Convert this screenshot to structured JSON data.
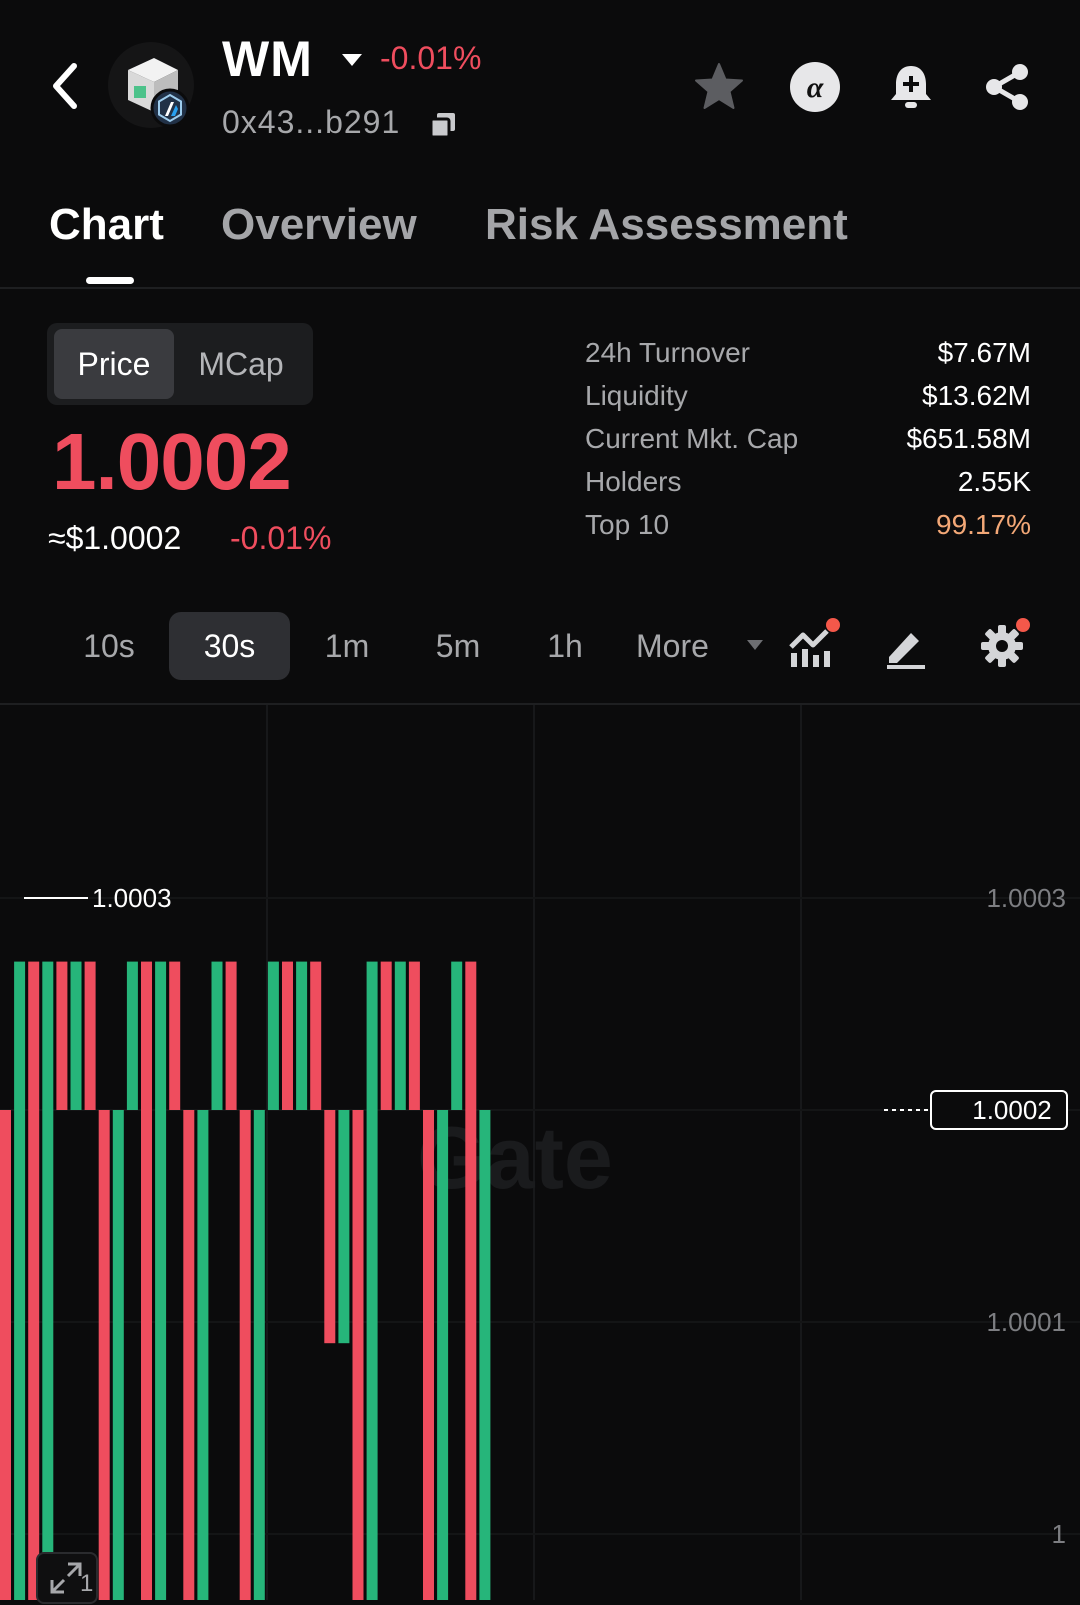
{
  "header": {
    "title": "WM",
    "change": "-0.01%",
    "address": "0x43...b291"
  },
  "tabs": [
    "Chart",
    "Overview",
    "Risk Assessment"
  ],
  "toggle": {
    "price": "Price",
    "mcap": "MCap"
  },
  "price": {
    "value": "1.0002",
    "usd": "≈$1.0002",
    "change": "-0.01%"
  },
  "stats": [
    {
      "label": "24h Turnover",
      "value": "$7.67M"
    },
    {
      "label": "Liquidity",
      "value": "$13.62M"
    },
    {
      "label": "Current Mkt. Cap",
      "value": "$651.58M"
    },
    {
      "label": "Holders",
      "value": "2.55K"
    },
    {
      "label": "Top 10",
      "value": "99.17%"
    }
  ],
  "timeframes": [
    "10s",
    "30s",
    "1m",
    "5m",
    "1h",
    "More"
  ],
  "selected_timeframe": "30s",
  "colors": {
    "up": "#26b57a",
    "down": "#ef4d5e",
    "top10": "#f3a877",
    "background": "#0b0b0c"
  },
  "icons": [
    "back-icon",
    "token-logo-icon",
    "arbitrum-badge-icon",
    "copy-icon",
    "star-icon",
    "alpha-icon",
    "bell-plus-icon",
    "share-icon",
    "indicators-icon",
    "draw-icon",
    "settings-icon",
    "expand-icon"
  ],
  "watermark": "Gate",
  "chart_data": {
    "type": "candlestick",
    "y_ticks": [
      "1.0003",
      "1.0002",
      "1.0001",
      "1"
    ],
    "high_label": "1.0003",
    "current_price_label": "1.0002",
    "corner_label": "1",
    "candles": [
      {
        "open": 1.0002,
        "close": 0.99993,
        "dir": "down"
      },
      {
        "open": 0.99993,
        "close": 1.00027,
        "dir": "up"
      },
      {
        "open": 1.00027,
        "close": 0.99993,
        "dir": "down"
      },
      {
        "open": 0.99993,
        "close": 1.00027,
        "dir": "up"
      },
      {
        "open": 1.00027,
        "close": 1.0002,
        "dir": "down"
      },
      {
        "open": 1.0002,
        "close": 1.00027,
        "dir": "up"
      },
      {
        "open": 1.00027,
        "close": 1.0002,
        "dir": "down"
      },
      {
        "open": 1.0002,
        "close": 0.99993,
        "dir": "down"
      },
      {
        "open": 0.99993,
        "close": 1.0002,
        "dir": "up"
      },
      {
        "open": 1.0002,
        "close": 1.00027,
        "dir": "up"
      },
      {
        "open": 1.00027,
        "close": 0.99993,
        "dir": "down"
      },
      {
        "open": 0.99993,
        "close": 1.00027,
        "dir": "up"
      },
      {
        "open": 1.00027,
        "close": 1.0002,
        "dir": "down"
      },
      {
        "open": 1.0002,
        "close": 0.99993,
        "dir": "down"
      },
      {
        "open": 0.99993,
        "close": 1.0002,
        "dir": "up"
      },
      {
        "open": 1.0002,
        "close": 1.00027,
        "dir": "up"
      },
      {
        "open": 1.00027,
        "close": 1.0002,
        "dir": "down"
      },
      {
        "open": 1.0002,
        "close": 0.99993,
        "dir": "down"
      },
      {
        "open": 0.99993,
        "close": 1.0002,
        "dir": "up"
      },
      {
        "open": 1.0002,
        "close": 1.00027,
        "dir": "up"
      },
      {
        "open": 1.00027,
        "close": 1.0002,
        "dir": "down"
      },
      {
        "open": 1.0002,
        "close": 1.00027,
        "dir": "up"
      },
      {
        "open": 1.00027,
        "close": 1.0002,
        "dir": "down"
      },
      {
        "open": 1.0002,
        "close": 1.00009,
        "dir": "down"
      },
      {
        "open": 1.00009,
        "close": 1.0002,
        "dir": "up"
      },
      {
        "open": 1.0002,
        "close": 0.99993,
        "dir": "down"
      },
      {
        "open": 0.99993,
        "close": 1.00027,
        "dir": "up"
      },
      {
        "open": 1.00027,
        "close": 1.0002,
        "dir": "down"
      },
      {
        "open": 1.0002,
        "close": 1.00027,
        "dir": "up"
      },
      {
        "open": 1.00027,
        "close": 1.0002,
        "dir": "down"
      },
      {
        "open": 1.0002,
        "close": 0.99993,
        "dir": "down"
      },
      {
        "open": 0.99993,
        "close": 1.0002,
        "dir": "up"
      },
      {
        "open": 1.0002,
        "close": 1.00027,
        "dir": "up"
      },
      {
        "open": 1.00027,
        "close": 0.99993,
        "dir": "down"
      },
      {
        "open": 0.99993,
        "close": 1.0002,
        "dir": "up"
      }
    ]
  }
}
